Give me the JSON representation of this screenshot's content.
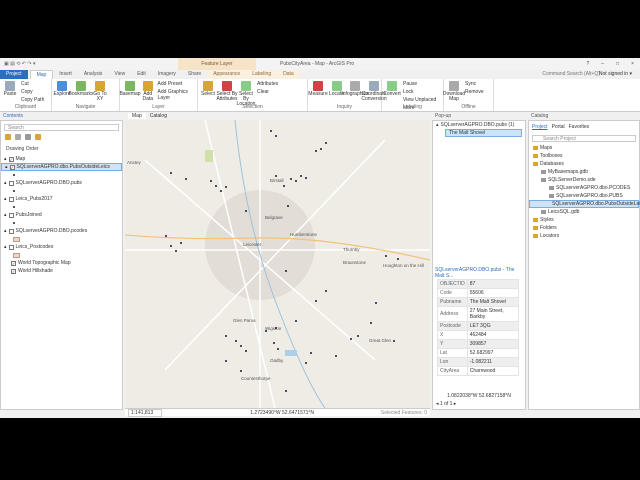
{
  "titlebar": {
    "title": "PubsCityArea - Map - ArcGIS Pro",
    "context": "Feature Layer",
    "help": "?",
    "min": "–",
    "max": "□",
    "close": "×"
  },
  "tabs": [
    "Project",
    "Map",
    "Insert",
    "Analysis",
    "View",
    "Edit",
    "Imagery",
    "Share",
    "Appearance",
    "Labeling",
    "Data"
  ],
  "command_search": "Command Search (Alt+Q)",
  "sign_in": "Not signed in ▾",
  "ribbon": [
    {
      "label": "Clipboard",
      "buttons": [
        "Paste"
      ],
      "small": [
        "Cut",
        "Copy",
        "Copy Path"
      ]
    },
    {
      "label": "Navigate",
      "buttons": [
        "Explore",
        "Bookmarks",
        "Go To XY"
      ]
    },
    {
      "label": "Layer",
      "buttons": [
        "Basemap",
        "Add Data"
      ],
      "small": [
        "Add Preset",
        "Add Graphics Layer"
      ]
    },
    {
      "label": "Selection",
      "buttons": [
        "Select",
        "Select By Attributes",
        "Select By Location"
      ],
      "small": [
        "Attributes",
        "Clear"
      ]
    },
    {
      "label": "Inquiry",
      "buttons": [
        "Measure",
        "Locate",
        "Infographics",
        "Coordinate Conversion"
      ]
    },
    {
      "label": "Labeling",
      "small": [
        "Pause",
        "Lock",
        "View Unplaced",
        "More"
      ],
      "buttons": [
        "Convert"
      ]
    },
    {
      "label": "Offline",
      "buttons": [
        "Download Map"
      ],
      "small": [
        "Sync",
        "Remove"
      ]
    }
  ],
  "contents": {
    "title": "Contents",
    "search_placeholder": "Search",
    "drawing_order": "Drawing Order",
    "layers": [
      "Map",
      "SQLserverAGPRO.dbo.PubsOutsideLeics",
      "SQLserverAGPRO.DBO.pubs",
      "Leics_Pubs2017",
      "PubsJoined",
      "SQLserverAGPRO.DBO.pcodes",
      "Leics_Postcodes",
      "World Topographic Map",
      "World Hillshade"
    ]
  },
  "view_tabs": [
    "Map",
    "Catalog"
  ],
  "map_labels": [
    "Birstall",
    "Belgrave",
    "Leicester",
    "Humberstone",
    "Thurnby",
    "Braunstone",
    "Glen Parva",
    "Wigston",
    "Oadby",
    "Great Glen",
    "Countesthorpe",
    "Houghton on the Hill",
    "Anstey"
  ],
  "popup": {
    "title": "Pop-up",
    "layer": "SQLserverAGPRO.DBO.pubs (1)",
    "feature": "The Malt Shovel",
    "header": "SQLserverAGPRO.DBO.pubs - The Malt S...",
    "fields": [
      [
        "OBJECTID",
        "87"
      ],
      [
        "Code",
        "55606"
      ],
      [
        "Pubname",
        "The Malt Shovel"
      ],
      [
        "Address",
        "27 Main Street, Barkby"
      ],
      [
        "Postcode",
        "LE7 3QG"
      ],
      [
        "X",
        "462484"
      ],
      [
        "Y",
        "309857"
      ],
      [
        "Lat",
        "52.682997"
      ],
      [
        "Lon",
        "-1.082211"
      ],
      [
        "CityArea",
        "Charnwood"
      ]
    ],
    "coords": "1.0822038°W 52.6827158°N",
    "pager": "1 of 1"
  },
  "catalog": {
    "title": "Catalog",
    "tabs": [
      "Project",
      "Portal",
      "Favorites"
    ],
    "search_placeholder": "Search Project",
    "items": [
      "Maps",
      "Toolboxes",
      "Databases",
      "MyBasemaps.gdb",
      "SQLServerDemo.sde",
      "SQLserverAGPRO.dbo.PCODES",
      "SQLserverAGPRO.dbo.PUBS",
      "SQLserverAGPRO.dbo.PubsOutsideLeics",
      "LeicsSQL.gdb",
      "Styles",
      "Folders",
      "Locators"
    ]
  },
  "status": {
    "scale": "1:141,813",
    "coords": "1.2723490°W 52.6471571°N",
    "selected": "Selected Features: 0"
  }
}
